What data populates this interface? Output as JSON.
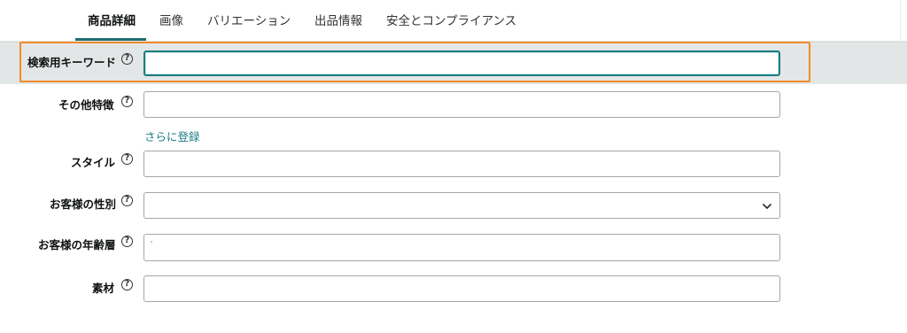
{
  "tabs": [
    {
      "label": "商品詳細",
      "active": true
    },
    {
      "label": "画像",
      "active": false
    },
    {
      "label": "バリエーション",
      "active": false
    },
    {
      "label": "出品情報",
      "active": false
    },
    {
      "label": "安全とコンプライアンス",
      "active": false
    }
  ],
  "help_icon_glyph": "?",
  "fields": {
    "search_keywords": {
      "label": "検索用キーワード",
      "value": "",
      "placeholder": ""
    },
    "other_features": {
      "label": "その他特徴",
      "value": "",
      "placeholder": ""
    },
    "register_more_link": "さらに登録",
    "style": {
      "label": "スタイル",
      "value": "",
      "placeholder": ""
    },
    "target_gender": {
      "label": "お客様の性別",
      "selected": ""
    },
    "age_range": {
      "label": "お客様の年齢層",
      "value": "",
      "placeholder": ""
    },
    "material": {
      "label": "素材",
      "value": "",
      "placeholder": ""
    }
  },
  "colors": {
    "accent_teal": "#1d7c7f",
    "highlight_orange": "#f08a2c",
    "link_teal": "#1d7c85",
    "band_gray": "#e3e6e6"
  }
}
